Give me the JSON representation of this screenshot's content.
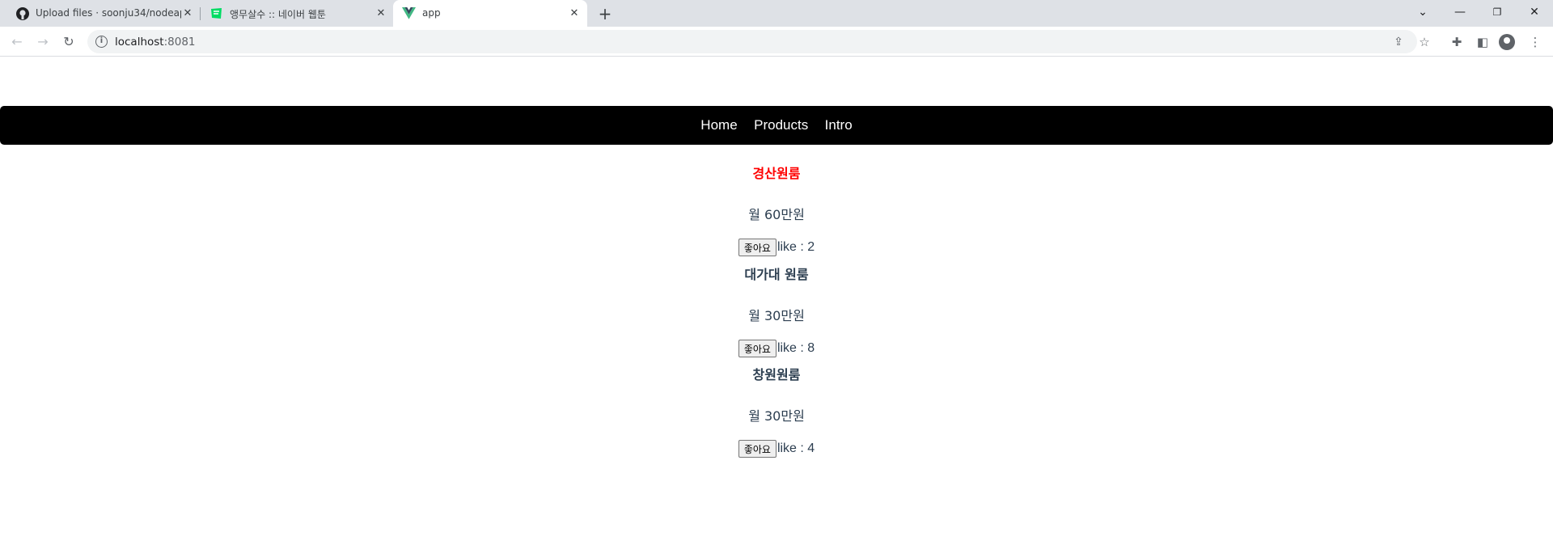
{
  "browser": {
    "tabs": [
      {
        "title": "Upload files · soonju34/nodeapp",
        "favicon": "github-icon",
        "active": false
      },
      {
        "title": "앵무살수 :: 네이버 웹툰",
        "favicon": "naver-webtoon-icon",
        "active": false
      },
      {
        "title": "app",
        "favicon": "vue-icon",
        "active": true
      }
    ],
    "url_host": "localhost",
    "url_port": ":8081"
  },
  "colors": {
    "menu_bg": "#000000",
    "highlight_title": "#ff0000",
    "text": "#2c3e50"
  },
  "menu": {
    "items": [
      "Home",
      "Products",
      "Intro"
    ]
  },
  "products": [
    {
      "name": "경산원룸",
      "price": "월 60만원",
      "like_button": "좋아요",
      "like_text": "like : 2"
    },
    {
      "name": "대가대 원룸",
      "price": "월 30만원",
      "like_button": "좋아요",
      "like_text": "like : 8"
    },
    {
      "name": "창원원룸",
      "price": "월 30만원",
      "like_button": "좋아요",
      "like_text": "like : 4"
    }
  ]
}
